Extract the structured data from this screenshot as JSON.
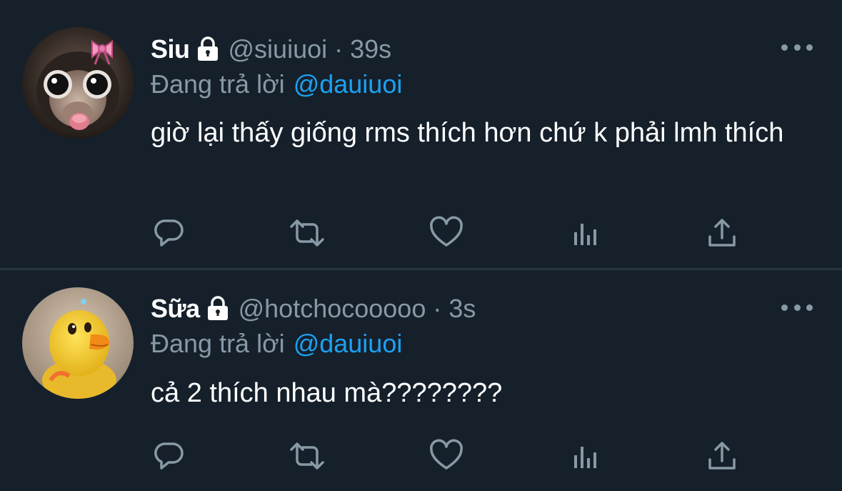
{
  "colors": {
    "background": "#15202b",
    "divider": "#263340",
    "primary_text": "#ffffff",
    "secondary_text": "#8899a6",
    "link": "#1da1f2"
  },
  "tweets": [
    {
      "author": {
        "display_name": "Siu",
        "handle": "@siuiuoi",
        "protected": true,
        "avatar": "monkey-with-pink-bow"
      },
      "separator": "·",
      "time": "39s",
      "reply": {
        "prefix": "Đang trả lời",
        "target": "@dauiuoi"
      },
      "text": "giờ lại thấy giống rms thích hơn chứ k phải lmh thích",
      "actions": [
        "reply-icon",
        "retweet-icon",
        "like-icon",
        "analytics-icon",
        "share-icon"
      ]
    },
    {
      "author": {
        "display_name": "Sữa",
        "handle": "@hotchocooooo",
        "protected": true,
        "avatar": "yellow-duck"
      },
      "separator": "·",
      "time": "3s",
      "reply": {
        "prefix": "Đang trả lời",
        "target": "@dauiuoi"
      },
      "text": "cả 2 thích nhau mà????????",
      "actions": [
        "reply-icon",
        "retweet-icon",
        "like-icon",
        "analytics-icon",
        "share-icon"
      ]
    }
  ]
}
